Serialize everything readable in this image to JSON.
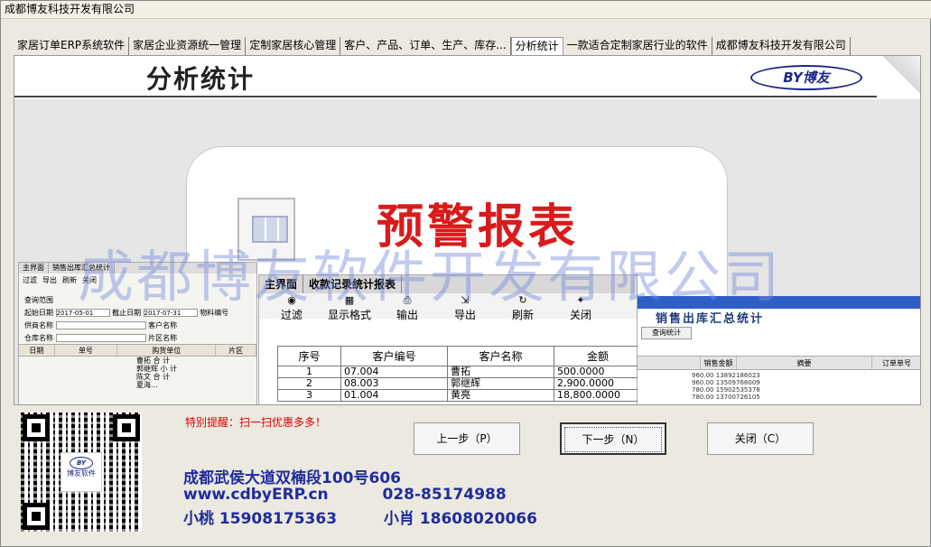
{
  "window": {
    "title": "成都博友科技开发有限公司"
  },
  "tabs": [
    "家居订单ERP系统软件",
    "家居企业资源统一管理",
    "定制家居核心管理",
    "客户、产品、订单、生产、库存...",
    "分析统计",
    "一款适合定制家居行业的软件",
    "成都博友科技开发有限公司"
  ],
  "active_tab": "分析统计",
  "header": {
    "title": "分析统计",
    "logo_text": "BY博友"
  },
  "card": {
    "title": "预警报表"
  },
  "watermark": "成都博友软件开发有限公司",
  "mini_report": {
    "tabs": [
      "主界面",
      "销售出库汇总统计"
    ],
    "tools": [
      "过滤",
      "导出",
      "刷新",
      "关闭"
    ],
    "section": "查询范围",
    "start_label": "起始日期",
    "start_value": "2017-05-01",
    "end_label": "截止日期",
    "end_value": "2017-07-31",
    "material_label": "物料编号",
    "vendor_label": "供商名称",
    "customer_label": "客户名称",
    "warehouse_label": "仓库名称",
    "area_label": "片区名称",
    "columns": [
      "日期",
      "单号",
      "购货单位",
      "片区"
    ],
    "subtotals": [
      "曹拓 合 计",
      "郭继辉 小 计",
      "陈文 合 计",
      "夏海..."
    ]
  },
  "center_report": {
    "tabs": [
      "主界面",
      "收款记录统计报表"
    ],
    "tools": [
      "过滤",
      "显示格式",
      "输出",
      "导出",
      "刷新",
      "关闭"
    ],
    "columns": [
      "序号",
      "客户编号",
      "客户名称",
      "金额"
    ],
    "rows": [
      [
        "1",
        "07.004",
        "曹拓",
        "500.0000"
      ],
      [
        "2",
        "08.003",
        "郭继辉",
        "2,900.0000"
      ],
      [
        "3",
        "01.004",
        "黄亮",
        "18,800.0000"
      ]
    ]
  },
  "right_report": {
    "title": "销售出库汇总统计",
    "query_button": "查询统计",
    "columns": [
      "销售金额",
      "摘要",
      "订单单号"
    ],
    "amounts": [
      "960.00",
      "960.00",
      "780.00",
      "780.00"
    ],
    "phones": [
      "13892186023",
      "13509768009",
      "15902535378",
      "13700726105"
    ]
  },
  "bottom": {
    "tip": "特别提醒：扫一扫优惠多多！",
    "qr_logo": "BY",
    "qr_label": "博友软件",
    "buttons": {
      "prev": "上一步（P）",
      "next": "下一步（N）",
      "close": "关闭（C）"
    },
    "address": "成都武侯大道双楠段100号606",
    "website": "www.cdbyERP.cn",
    "phone": "028-85174988",
    "contact1": "小桃 15908175363",
    "contact2": "小肖 18608020066"
  }
}
